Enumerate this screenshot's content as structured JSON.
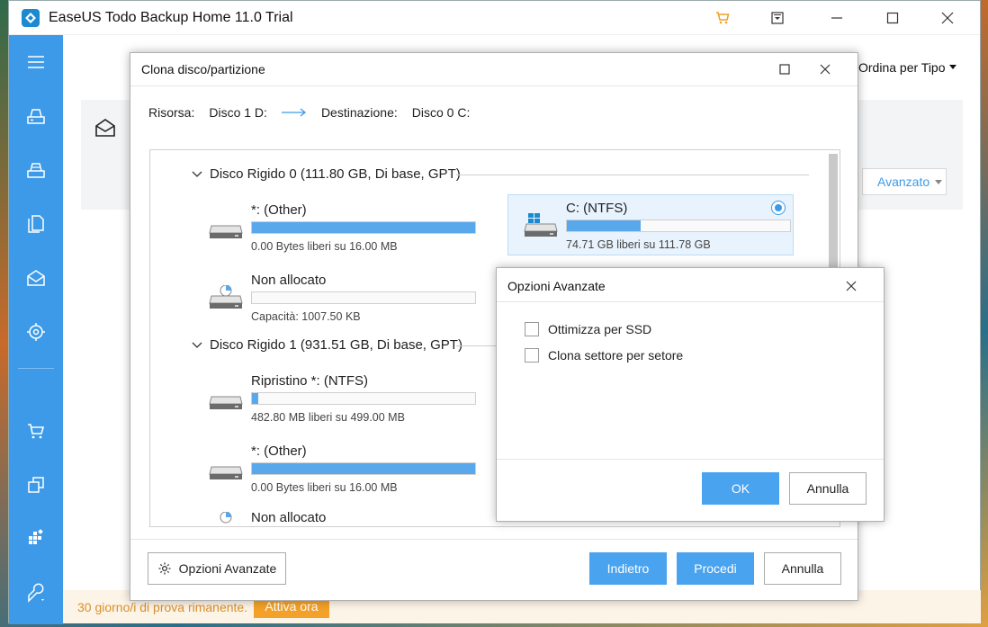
{
  "app": {
    "title": "EaseUS Todo Backup Home 11.0 Trial",
    "sort_label": "Ordina per Tipo",
    "advanced_button": "Avanzato",
    "trial_text": "30 giorno/i di prova rimanente.",
    "activate_button": "Attiva ora"
  },
  "sidebar": {
    "icons": [
      "menu-icon",
      "disk-backup-icon",
      "partition-backup-icon",
      "file-backup-icon",
      "mail-backup-icon",
      "target-icon",
      "cart-icon",
      "clone-icon",
      "tools-grid-icon",
      "wrench-icon"
    ]
  },
  "clone_dialog": {
    "title": "Clona disco/partizione",
    "source_label": "Risorsa:",
    "source_value": "Disco 1 D:",
    "dest_label": "Destinazione:",
    "dest_value": "Disco 0 C:",
    "groups": [
      {
        "label": "Disco Rigido 0 (111.80 GB, Di base, GPT)",
        "partitions": [
          {
            "name": "*: (Other)",
            "info": "0.00 Bytes liberi su 16.00 MB",
            "used": 1.0
          },
          {
            "name": "C: (NTFS)",
            "info": "74.71 GB liberi su 111.78 GB",
            "used": 0.33,
            "selected": true
          },
          {
            "name": "Non allocato",
            "info": "Capacità: 1007.50 KB",
            "used": 0.0
          }
        ]
      },
      {
        "label": "Disco Rigido 1 (931.51 GB, Di base, GPT)",
        "partitions": [
          {
            "name": "Ripristino *: (NTFS)",
            "info": "482.80 MB liberi su 499.00 MB",
            "used": 0.03
          },
          {
            "name": "*: (Other)",
            "info": "0.00 Bytes liberi su 16.00 MB",
            "used": 1.0
          },
          {
            "name": "Non allocato",
            "info": "",
            "used": 0.0
          }
        ]
      }
    ],
    "advanced_options_button": "Opzioni Avanzate",
    "back_button": "Indietro",
    "proceed_button": "Procedi",
    "cancel_button": "Annulla"
  },
  "advanced_dialog": {
    "title": "Opzioni Avanzate",
    "options": [
      {
        "label": "Ottimizza per SSD",
        "checked": false
      },
      {
        "label": "Clona settore per setore",
        "checked": false
      }
    ],
    "ok_button": "OK",
    "cancel_button": "Annulla"
  },
  "colors": {
    "accent": "#3d9ae8",
    "trial_orange": "#f3a128",
    "bar_fill": "#5aa8ec"
  }
}
